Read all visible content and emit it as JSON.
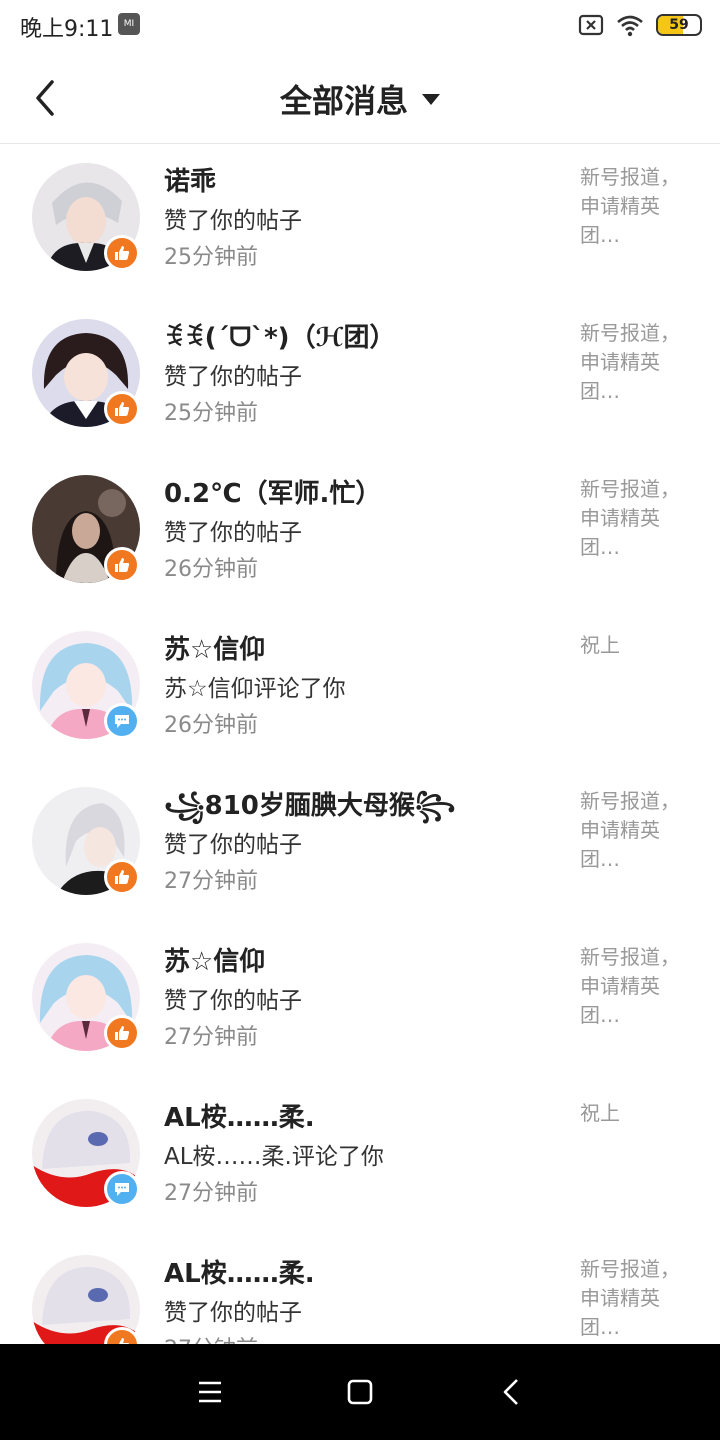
{
  "status_bar": {
    "time": "晚上9:11",
    "mi_icon_text": "MI",
    "battery": "59",
    "battery_level": 0.59
  },
  "header": {
    "title": "全部消息"
  },
  "messages": [
    {
      "name": "诺乖",
      "action": "赞了你的帖子",
      "time": "25分钟前",
      "preview": "新号报道，申请精英团…",
      "type": "like"
    },
    {
      "name": "ꉂꉂ(ˊᗜˋ*)（ℋ团）",
      "action": "赞了你的帖子",
      "time": "25分钟前",
      "preview": "新号报道，申请精英团…",
      "type": "like"
    },
    {
      "name": "0.2℃（军师.忙）",
      "action": "赞了你的帖子",
      "time": "26分钟前",
      "preview": "新号报道，申请精英团…",
      "type": "like"
    },
    {
      "name": "苏☆信仰",
      "action": "苏☆信仰评论了你",
      "time": "26分钟前",
      "preview": "祝上",
      "type": "comment"
    },
    {
      "name": "꧁810岁腼腆大母猴꧂",
      "action": "赞了你的帖子",
      "time": "27分钟前",
      "preview": "新号报道，申请精英团…",
      "type": "like"
    },
    {
      "name": "苏☆信仰",
      "action": "赞了你的帖子",
      "time": "27分钟前",
      "preview": "新号报道，申请精英团…",
      "type": "like"
    },
    {
      "name": "AL桉……柔.",
      "action": "AL桉……柔.评论了你",
      "time": "27分钟前",
      "preview": "祝上",
      "type": "comment"
    },
    {
      "name": "AL桉……柔.",
      "action": "赞了你的帖子",
      "time": "27分钟前",
      "preview": "新号报道，申请精英团…",
      "type": "like"
    }
  ],
  "colors": {
    "like_badge": "#f07820",
    "comment_badge": "#52b0f0",
    "nav_bar": "#000000"
  },
  "icons": {
    "back": "chevron-left-icon",
    "dropdown": "caret-down-icon",
    "like": "thumbs-up-icon",
    "comment": "chat-bubble-icon",
    "nav_menu": "menu-icon",
    "nav_home": "square-home-icon",
    "nav_back": "back-triangle-icon"
  }
}
